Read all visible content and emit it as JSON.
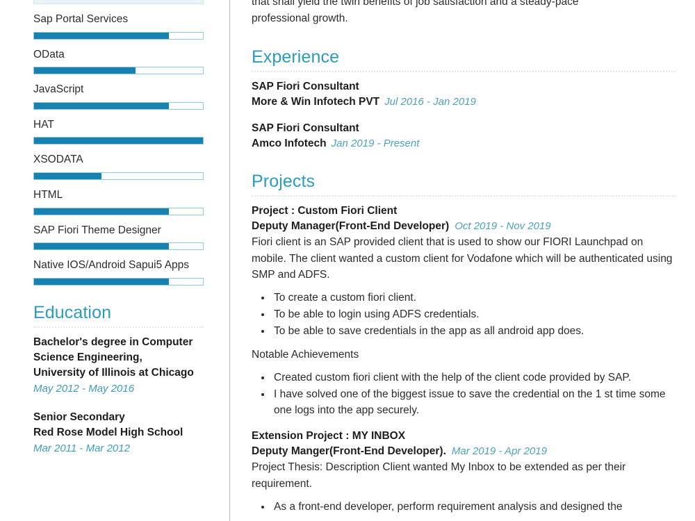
{
  "document": {
    "type": "resume",
    "accent_heading_color": "#2b9cc0",
    "accent_date_color": "#4ba3bd",
    "bar_fill_color": "#1782b0",
    "bar_border_color": "#8fc9da"
  },
  "sidebar": {
    "skills": {
      "items": [
        {
          "label": "Sap Portal Services",
          "percent": 80
        },
        {
          "label": "OData",
          "percent": 60
        },
        {
          "label": "JavaScript",
          "percent": 80
        },
        {
          "label": "HAT",
          "percent": 100
        },
        {
          "label": "XSODATA",
          "percent": 40
        },
        {
          "label": "HTML",
          "percent": 80
        },
        {
          "label": "SAP Fiori Theme Designer",
          "percent": 80
        },
        {
          "label": "Native IOS/Android Sapui5 Apps",
          "percent": 80
        }
      ]
    },
    "education": {
      "heading": "Education",
      "items": [
        {
          "title": "Bachelor's degree in Computer Science Engineering,\nUniversity of Illinois at Chicago",
          "date": "May 2012 - May 2016"
        },
        {
          "title": "Senior Secondary\nRed Rose Model High School",
          "date": "Mar 2011 - Mar 2012"
        }
      ]
    }
  },
  "main": {
    "intro": {
      "clipped_line": "that shall yield the twin benefits of job satisfaction and a steady-pace",
      "line2": "professional growth."
    },
    "experience": {
      "heading": "Experience",
      "items": [
        {
          "role": "SAP Fiori Consultant",
          "company": "More & Win Infotech PVT",
          "date": "Jul 2016 - Jan 2019"
        },
        {
          "role": "SAP Fiori Consultant",
          "company": "Amco Infotech",
          "date": "Jan 2019 - Present"
        }
      ]
    },
    "projects": {
      "heading": "Projects",
      "items": [
        {
          "title": "Project : Custom Fiori Client",
          "role": "Deputy Manager(Front-End Developer)",
          "date": "Oct 2019 - Nov 2019",
          "description": "Fiori client is an SAP provided client that is used to show our FIORI Launchpad on mobile. The client wanted a custom client for Vodafone which will be authenticated using SMP and ADFS.",
          "bullets": [
            "To create a custom fiori client.",
            "To be able to login using ADFS credentials.",
            "To be able to save credentials in the app as all android app does."
          ],
          "sub_label": "Notable Achievements",
          "achievements": [
            "Created custom fiori client with the help of the client code provided by SAP.",
            "I have solved one of the biggest issue to save the credential on the 1 st time some one logs into the app securely."
          ]
        },
        {
          "title": "Extension Project : MY INBOX",
          "role": "Deputy Manger(Front-End Developer).",
          "date": "Mar 2019 - Apr 2019",
          "description": "Project Thesis: Description Client wanted My Inbox to be extended as per their requirement.",
          "bullets": [
            "As a front-end developer, perform requirement analysis and designed the"
          ]
        }
      ]
    }
  }
}
